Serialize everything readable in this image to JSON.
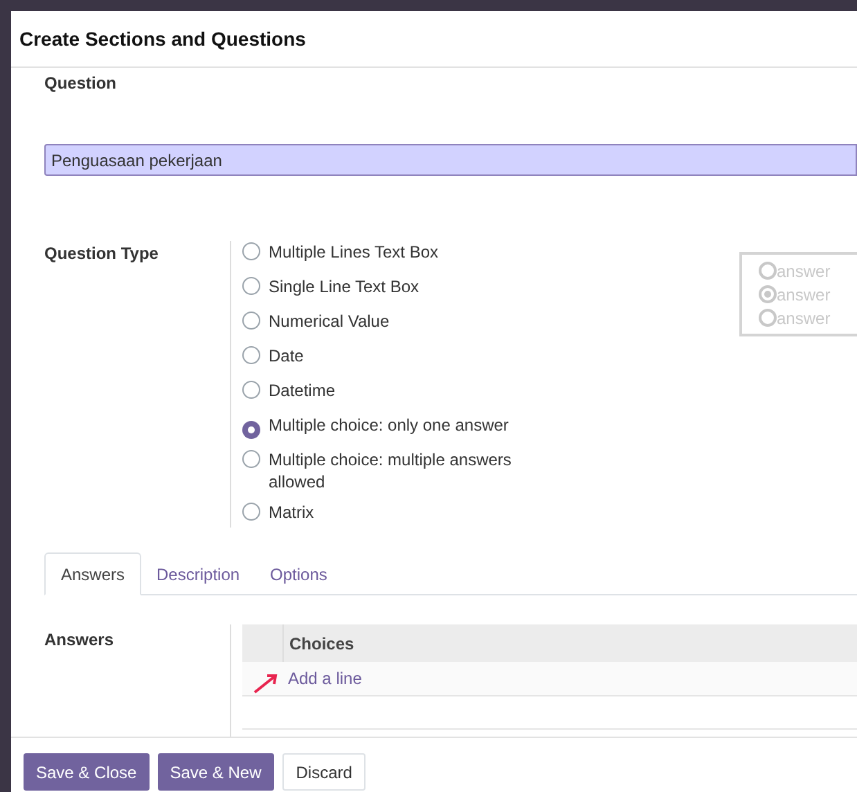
{
  "dialog": {
    "title": "Create Sections and Questions"
  },
  "question": {
    "label": "Question",
    "value": "Penguasaan pekerjaan"
  },
  "question_type": {
    "label": "Question Type",
    "options": [
      {
        "label": "Multiple Lines Text Box",
        "selected": false
      },
      {
        "label": "Single Line Text Box",
        "selected": false
      },
      {
        "label": "Numerical Value",
        "selected": false
      },
      {
        "label": "Date",
        "selected": false
      },
      {
        "label": "Datetime",
        "selected": false
      },
      {
        "label": "Multiple choice: only one answer",
        "selected": true
      },
      {
        "label": "Multiple choice: multiple answers allowed",
        "selected": false
      },
      {
        "label": "Matrix",
        "selected": false
      }
    ],
    "preview": [
      {
        "label": "answer",
        "selected": false
      },
      {
        "label": "answer",
        "selected": true
      },
      {
        "label": "answer",
        "selected": false
      }
    ]
  },
  "tabs": [
    {
      "label": "Answers",
      "selected": true
    },
    {
      "label": "Description",
      "selected": false
    },
    {
      "label": "Options",
      "selected": false
    }
  ],
  "answers": {
    "label": "Answers",
    "columns": [
      "Choices"
    ],
    "add_line": "Add a line"
  },
  "buttons": [
    {
      "label": "Save & Close",
      "kind": "primary"
    },
    {
      "label": "Save & New",
      "kind": "primary"
    },
    {
      "label": "Discard",
      "kind": "secondary"
    }
  ]
}
